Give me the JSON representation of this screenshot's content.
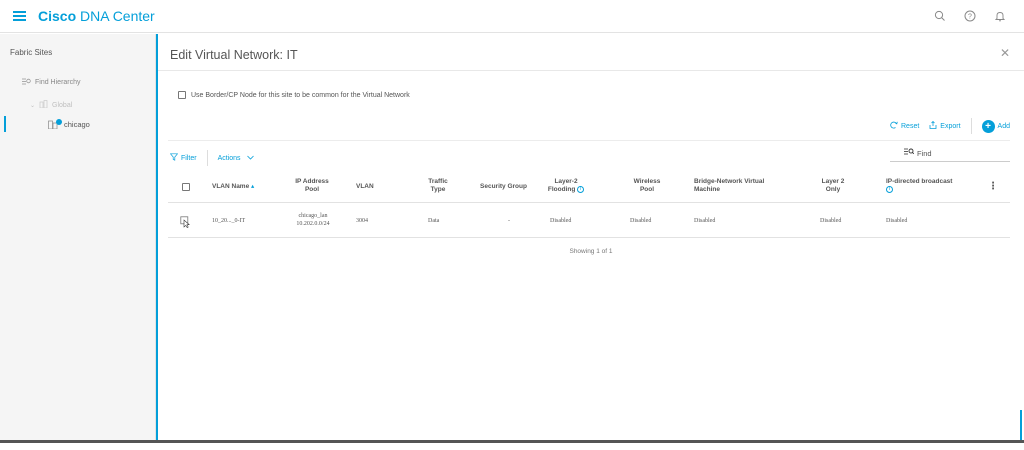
{
  "header": {
    "brand_bold": "Cisco",
    "brand_rest": " DNA Center"
  },
  "sidebar": {
    "title": "Fabric Sites",
    "find_hierarchy": "Find Hierarchy",
    "tree": {
      "global": "Global",
      "chicago": "chicago"
    }
  },
  "panel": {
    "title": "Edit Virtual Network: IT",
    "use_border_label": "Use Border/CP Node for this site to be common for the Virtual Network",
    "toolbar": {
      "reset": "Reset",
      "export": "Export",
      "add": "Add"
    },
    "filter_label": "Filter",
    "actions_label": "Actions",
    "find_placeholder": "Find",
    "table": {
      "headers": {
        "vlan_name": "VLAN Name",
        "ip_pool": "IP Address Pool",
        "vlan": "VLAN",
        "traffic_type": "Traffic Type",
        "security_group": "Security Group",
        "l2_flooding": "Layer-2 Flooding",
        "wireless_pool": "Wireless Pool",
        "bridge_vm": "Bridge-Network Virtual Machine",
        "layer2_only": "Layer 2 Only",
        "ip_broadcast": "IP-directed broadcast"
      },
      "rows": [
        {
          "vlan_name": "10_20..._0-IT",
          "ip_pool_name": "chicago_lan",
          "ip_pool_subnet": "10.202.0.0/24",
          "vlan": "3004",
          "traffic_type": "Data",
          "security_group": "-",
          "l2_flooding": "Disabled",
          "wireless_pool": "Disabled",
          "bridge_vm": "Disabled",
          "layer2_only": "Disabled",
          "ip_broadcast": "Disabled"
        }
      ]
    },
    "showing": "Showing 1 of 1"
  },
  "colors": {
    "accent": "#049fd9"
  }
}
